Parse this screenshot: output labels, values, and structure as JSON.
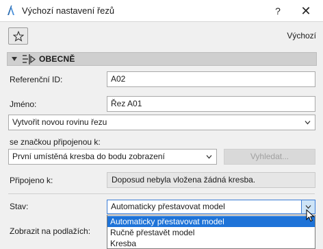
{
  "window": {
    "title": "Výchozí nastavení řezů",
    "help": "?",
    "close": "✕"
  },
  "toolbar": {
    "default_label": "Výchozí"
  },
  "section": {
    "title": "OBECNĚ"
  },
  "form": {
    "ref_id_label": "Referenční ID:",
    "ref_id_value": "A02",
    "name_label": "Jméno:",
    "name_value": "Řez A01",
    "plane_mode": "Vytvořit novou rovinu řezu",
    "marker_label": "se značkou připojenou k:",
    "marker_value": "První umístěná kresba do bodu zobrazení",
    "search_button": "Vyhledat...",
    "linked_label": "Připojeno k:",
    "linked_value": "Doposud nebyla vložena žádná kresba.",
    "status_label": "Stav:",
    "status_value": "Automaticky přestavovat model",
    "floors_label": "Zobrazit na podlažích:"
  },
  "status_options": [
    "Automaticky přestavovat model",
    "Ručně přestavět model",
    "Kresba"
  ],
  "colors": {
    "selection": "#1e73d8",
    "focus_border": "#3a7bd5",
    "section_bar": "#cfcfcf"
  }
}
